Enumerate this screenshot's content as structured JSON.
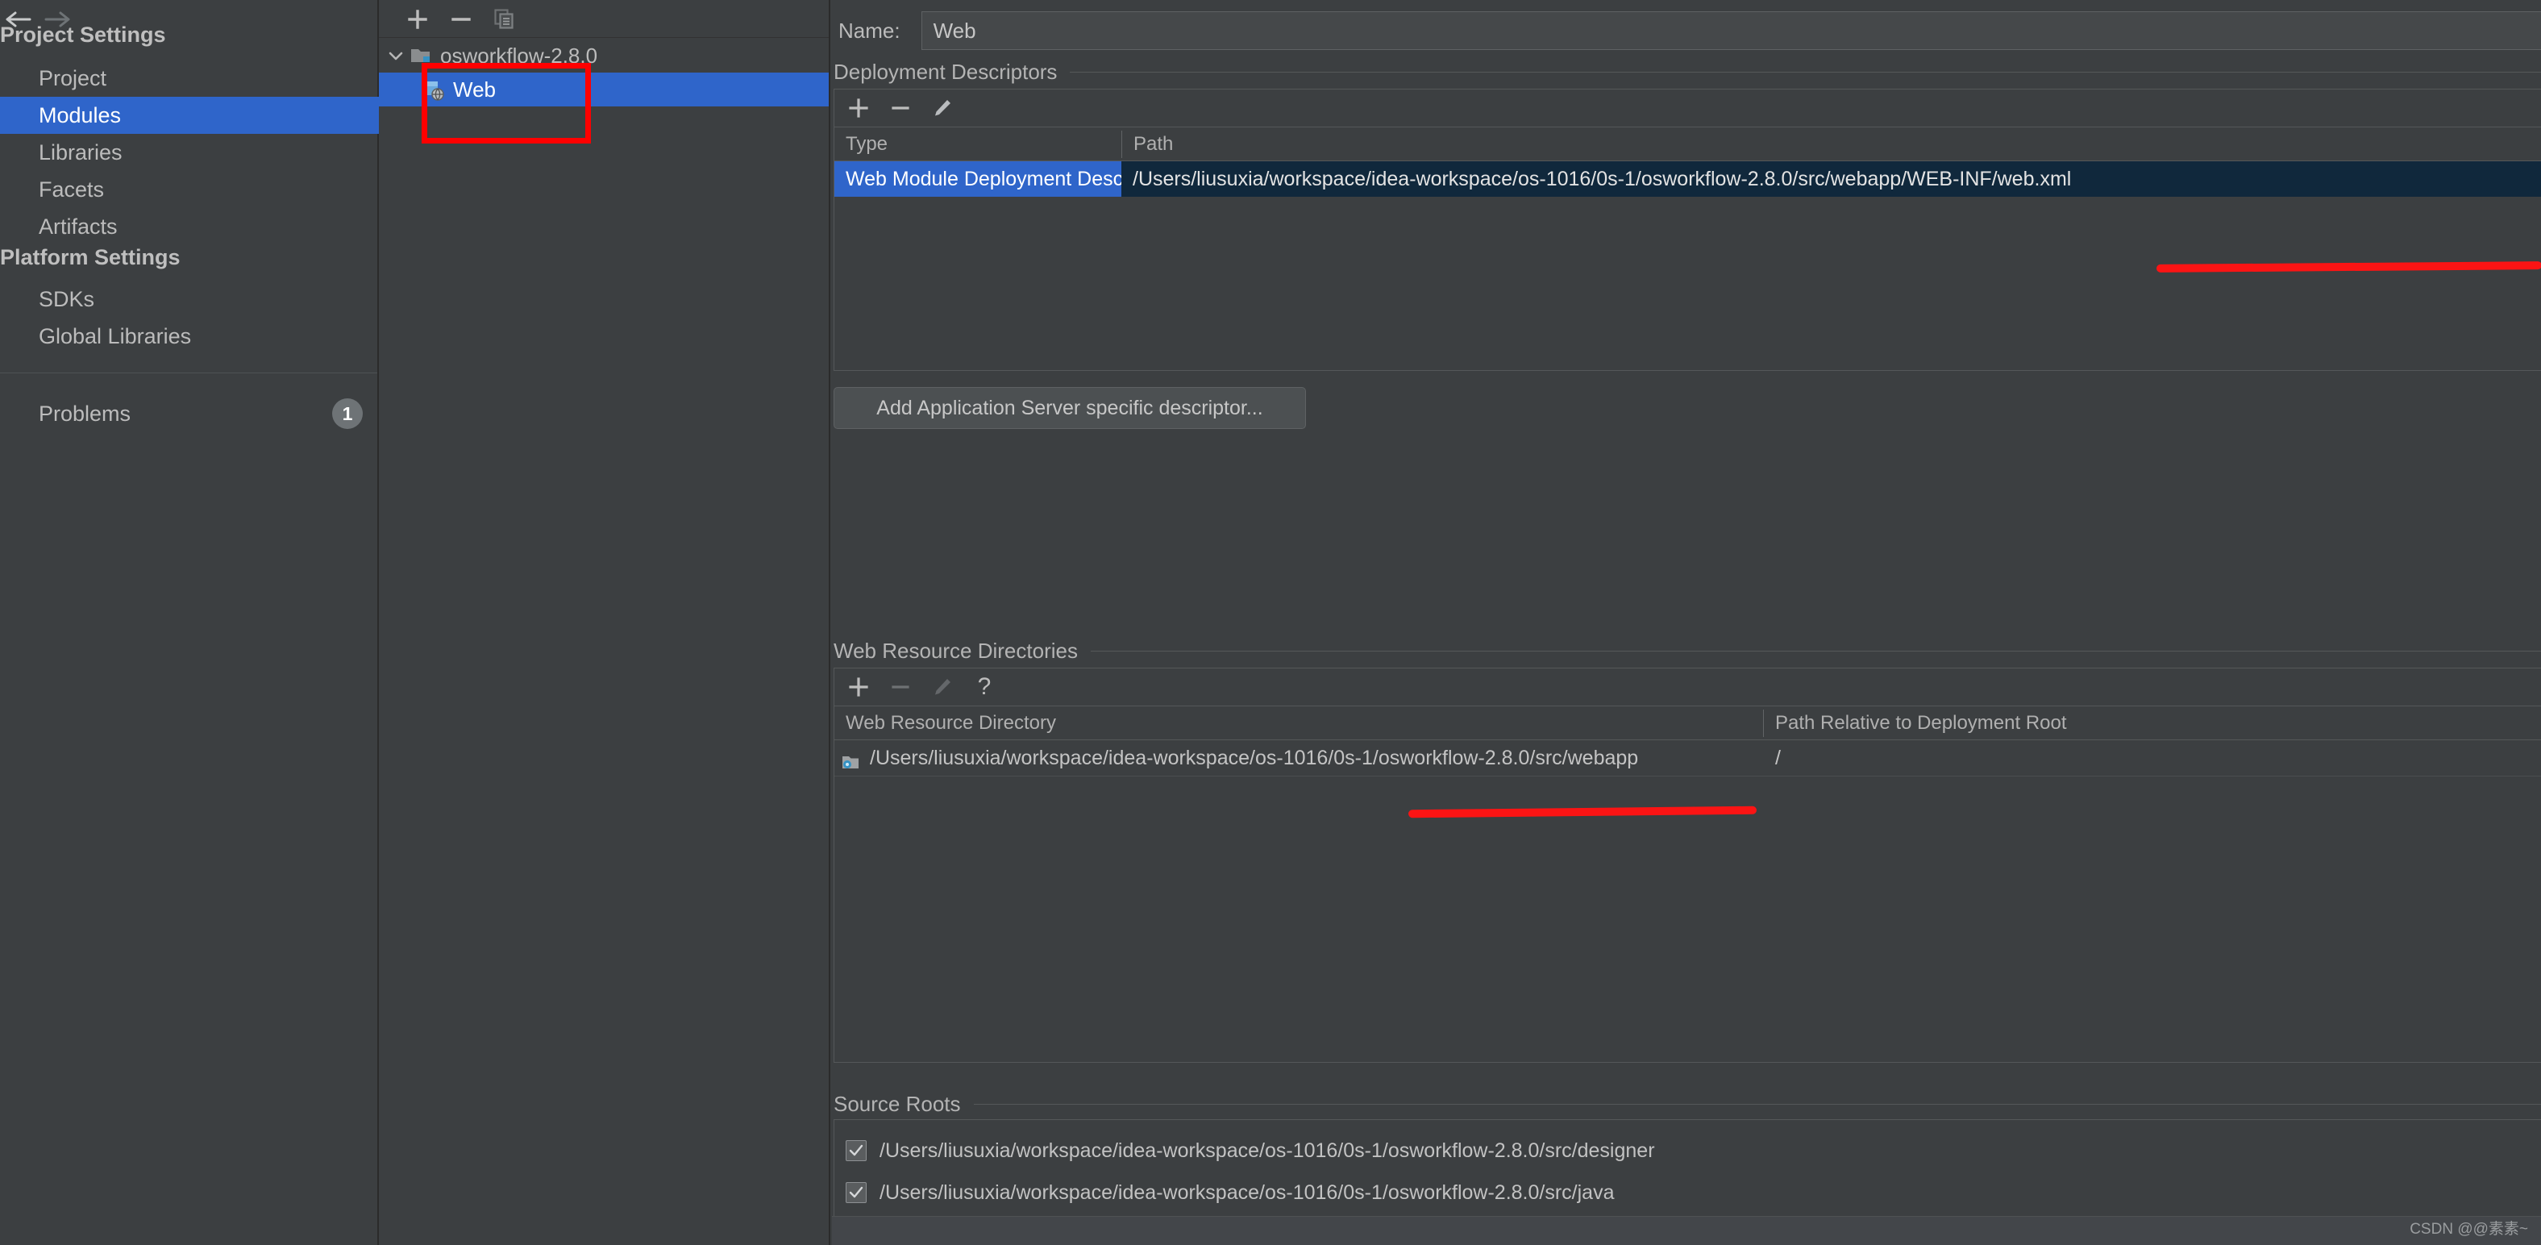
{
  "sidebar": {
    "nav": {
      "back_icon": "arrow-left-icon",
      "forward_icon": "arrow-right-icon"
    },
    "sections": [
      {
        "title": "Project Settings",
        "items": [
          {
            "label": "Project",
            "selected": false
          },
          {
            "label": "Modules",
            "selected": true
          },
          {
            "label": "Libraries",
            "selected": false
          },
          {
            "label": "Facets",
            "selected": false
          },
          {
            "label": "Artifacts",
            "selected": false
          }
        ]
      },
      {
        "title": "Platform Settings",
        "items": [
          {
            "label": "SDKs",
            "selected": false
          },
          {
            "label": "Global Libraries",
            "selected": false
          }
        ]
      }
    ],
    "problems": {
      "label": "Problems",
      "count": "1"
    }
  },
  "tree": {
    "toolbar": [
      {
        "name": "add-module-button",
        "glyph": "+"
      },
      {
        "name": "remove-module-button",
        "glyph": "−"
      },
      {
        "name": "copy-module-button",
        "glyph": "copy-icon"
      }
    ],
    "nodes": [
      {
        "label": "osworkflow-2.8.0",
        "icon": "folder-icon",
        "expanded": true,
        "selected": false
      },
      {
        "label": "Web",
        "icon": "web-module-icon",
        "selected": true
      }
    ]
  },
  "main": {
    "name_field": {
      "label": "Name:",
      "value": "Web"
    },
    "deployment_descriptors": {
      "title": "Deployment Descriptors",
      "toolbar": [
        {
          "name": "add-descriptor-button",
          "glyph": "+"
        },
        {
          "name": "remove-descriptor-button",
          "glyph": "−"
        },
        {
          "name": "edit-descriptor-button",
          "glyph": "pencil-icon"
        }
      ],
      "columns": [
        "Type",
        "Path"
      ],
      "rows": [
        {
          "type": "Web Module Deployment Descriptor",
          "path": "/Users/liusuxia/workspace/idea-workspace/os-1016/0s-1/osworkflow-2.8.0/src/webapp/WEB-INF/web.xml",
          "selected": true
        }
      ],
      "add_server_descriptor_button": "Add Application Server specific descriptor..."
    },
    "web_resource_directories": {
      "title": "Web Resource Directories",
      "toolbar": [
        {
          "name": "add-web-resource-button",
          "glyph": "+"
        },
        {
          "name": "remove-web-resource-button",
          "glyph": "−"
        },
        {
          "name": "edit-web-resource-button",
          "glyph": "pencil-icon"
        },
        {
          "name": "help-web-resource-button",
          "glyph": "?"
        }
      ],
      "columns": [
        "Web Resource Directory",
        "Path Relative to Deployment Root"
      ],
      "rows": [
        {
          "directory": "/Users/liusuxia/workspace/idea-workspace/os-1016/0s-1/osworkflow-2.8.0/src/webapp",
          "relative_path": "/",
          "icon": "folder-web-icon"
        }
      ]
    },
    "source_roots": {
      "title": "Source Roots",
      "items": [
        {
          "label": "/Users/liusuxia/workspace/idea-workspace/os-1016/0s-1/osworkflow-2.8.0/src/designer",
          "checked": true
        },
        {
          "label": "/Users/liusuxia/workspace/idea-workspace/os-1016/0s-1/osworkflow-2.8.0/src/java",
          "checked": true
        }
      ]
    }
  },
  "watermark": "CSDN @@素素~",
  "colors": {
    "background": "#3c3f41",
    "selection_blue": "#2f65ca",
    "annotation_red": "#ff0000",
    "path_cell_dark": "#10283c",
    "text": "#bbbbbb"
  }
}
